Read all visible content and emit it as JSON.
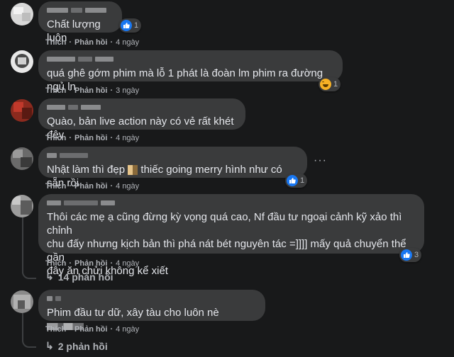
{
  "actions": {
    "like": "Thích",
    "reply": "Phản hồi",
    "sep": "·"
  },
  "comments": [
    {
      "text": "Chất lượng luôn",
      "time": "4 ngày",
      "reaction_count": "1",
      "reaction": "like"
    },
    {
      "text": "quá ghê gớm phim mà lỗ 1 phát là đoàn lm phim ra đường ngủ ln",
      "time": "3 ngày",
      "reaction_count": "1",
      "reaction": "haha"
    },
    {
      "text": "Quào, bản live action này có vẻ rất khét đêy",
      "time": "4 ngày"
    },
    {
      "text": "Nhật làm thì đẹp",
      "text2": "thiếc going merry hình như có sẵn rồi",
      "time": "4 ngày",
      "reaction_count": "1",
      "reaction": "like"
    },
    {
      "text": "Thôi các mẹ ạ cũng đừng kỳ vọng quá cao, Nf đầu tư ngoại cảnh kỹ xảo thì chỉnh\nchu đấy nhưng kịch bản thì phá nát bét nguyên tác =]]]] mấy quả chuyển thể gần\nđây ăn chửi không kể xiết",
      "time": "4 ngày",
      "reaction_count": "3",
      "reaction": "like",
      "replies": "14 phản hồi"
    },
    {
      "text": "Phim đầu tư dữ, xây tàu cho luôn nè",
      "time": "4 ngày",
      "replies": "2 phản hồi"
    }
  ],
  "icons": {
    "like": "like-thumb-icon",
    "haha": "haha-emoji-icon",
    "more": "more-options-icon",
    "reply_arrow": "reply-arrow-icon"
  },
  "colors": {
    "background": "#18191a",
    "bubble": "#3a3b3c",
    "text": "#e4e6eb",
    "secondary": "#b0b3b8",
    "like": "#1877f2"
  }
}
